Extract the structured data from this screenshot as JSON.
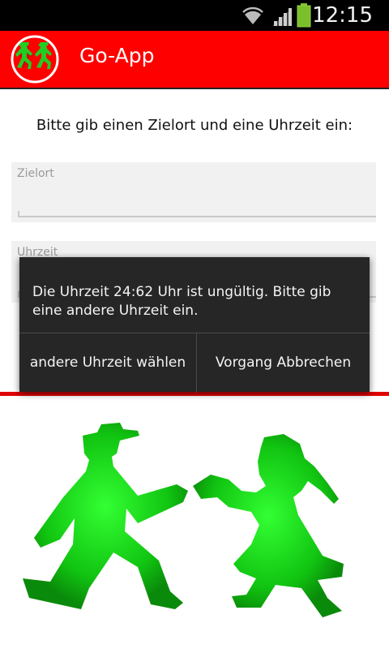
{
  "status_bar": {
    "time": "12:15",
    "icons": [
      "wifi-icon",
      "signal-icon",
      "battery-icon"
    ]
  },
  "action_bar": {
    "title": "Go-App",
    "logo": "ampelmann-logo-icon",
    "color": "#ff0000"
  },
  "form": {
    "prompt": "Bitte gib einen Zielort und eine Uhrzeit ein:",
    "destination_label": "Zielort",
    "destination_value": "",
    "time_label": "Uhrzeit",
    "time_value": ""
  },
  "dialog": {
    "message": "Die Uhrzeit 24:62 Uhr ist ungültig. Bitte gib eine andere Uhrzeit ein.",
    "button_choose": "andere Uhrzeit wählen",
    "button_cancel": "Vorgang Abbrechen"
  },
  "illustration": {
    "icons": [
      "ampelmann-walking-icon",
      "ampelfrau-walking-icon"
    ],
    "color": "#00cc00"
  }
}
